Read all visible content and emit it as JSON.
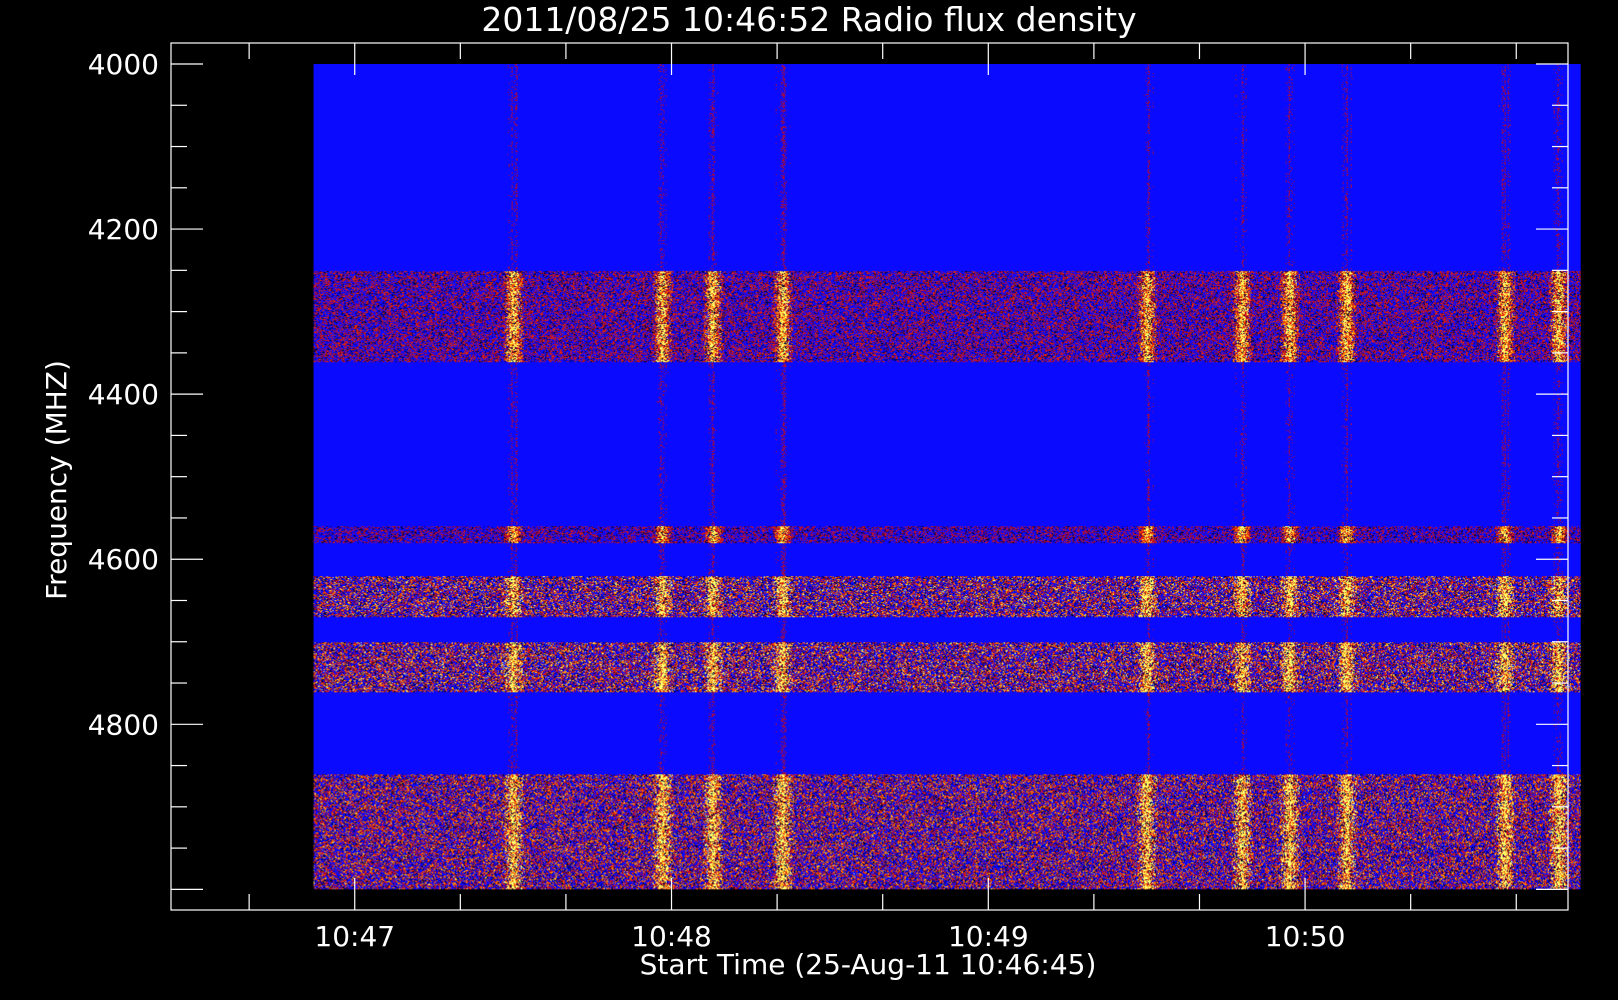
{
  "chart_data": {
    "type": "heatmap",
    "title": "2011/08/25 10:46:52 Radio flux density",
    "xlabel": "Start Time (25-Aug-11 10:46:45)",
    "ylabel": "Frequency (MHZ)",
    "x_ticks": [
      {
        "label": "10:47",
        "minutes": 0.25
      },
      {
        "label": "10:48",
        "minutes": 1.25
      },
      {
        "label": "10:49",
        "minutes": 2.25
      },
      {
        "label": "10:50",
        "minutes": 3.25
      }
    ],
    "xlim_minutes": [
      -0.33,
      4.08
    ],
    "data_x_range_minutes": [
      0.12,
      4.12
    ],
    "y_ticks": [
      4000,
      4200,
      4400,
      4600,
      4800
    ],
    "ylim": [
      4000,
      5025
    ],
    "data_y_range": [
      4000,
      5000
    ],
    "y_inverted": true,
    "colormap": [
      "#000000",
      "#0000ff",
      "#c00000",
      "#ff3000",
      "#ffa000",
      "#ffff60"
    ],
    "background_color": "#0000ff",
    "emission_bands_mhz": [
      {
        "from": 4250,
        "to": 4360,
        "intensity": 0.55
      },
      {
        "from": 4560,
        "to": 4580,
        "intensity": 0.45
      },
      {
        "from": 4620,
        "to": 4670,
        "intensity": 0.8
      },
      {
        "from": 4700,
        "to": 4760,
        "intensity": 0.8
      },
      {
        "from": 4860,
        "to": 5000,
        "intensity": 0.75
      }
    ],
    "burst_times_minutes": [
      0.75,
      1.22,
      1.38,
      1.6,
      2.75,
      3.05,
      3.2,
      3.38,
      3.88,
      4.05
    ]
  }
}
